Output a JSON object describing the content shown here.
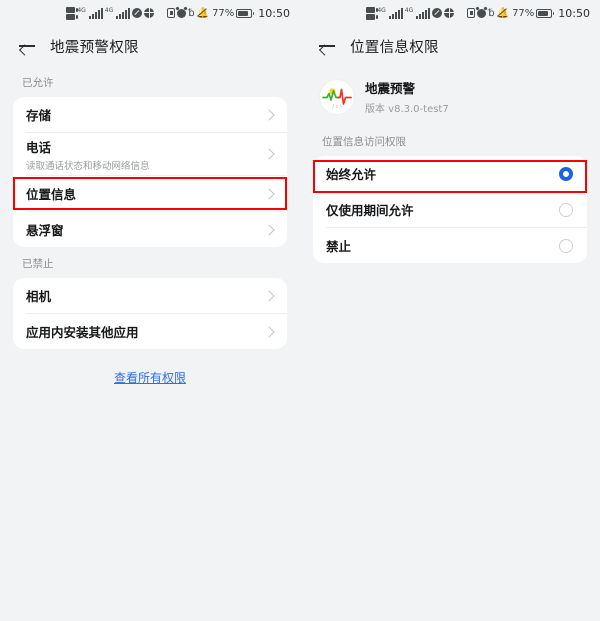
{
  "status_bar": {
    "network_label_1": "4G",
    "network_label_2": "4G",
    "battery_percent": "77%",
    "time": "10:50",
    "icons": [
      "dual-sim-icon",
      "signal-bars-icon",
      "signal-bars-icon",
      "do-not-disturb-icon",
      "globe-icon",
      "vpn-icon",
      "alarm-icon",
      "bluetooth-icon",
      "bell-muted-icon",
      "battery-icon"
    ]
  },
  "left_panel": {
    "title": "地震预警权限",
    "back_icon": "back-arrow-icon",
    "sections": [
      {
        "label": "已允许",
        "items": [
          {
            "title": "存储",
            "subtitle": "",
            "highlighted": false
          },
          {
            "title": "电话",
            "subtitle": "读取通话状态和移动网络信息",
            "highlighted": false
          },
          {
            "title": "位置信息",
            "subtitle": "",
            "highlighted": true
          },
          {
            "title": "悬浮窗",
            "subtitle": "",
            "highlighted": false
          }
        ]
      },
      {
        "label": "已禁止",
        "items": [
          {
            "title": "相机",
            "subtitle": "",
            "highlighted": false
          },
          {
            "title": "应用内安装其他应用",
            "subtitle": "",
            "highlighted": false
          }
        ]
      }
    ],
    "all_permissions_link": "查看所有权限"
  },
  "right_panel": {
    "title": "位置信息权限",
    "back_icon": "back-arrow-icon",
    "app": {
      "name": "地震预警",
      "version": "版本 v8.3.0-test7",
      "icon": "earthquake-warning-app-icon"
    },
    "section_label": "位置信息访问权限",
    "options": [
      {
        "label": "始终允许",
        "selected": true,
        "highlighted": true
      },
      {
        "label": "仅使用期间允许",
        "selected": false,
        "highlighted": false
      },
      {
        "label": "禁止",
        "selected": false,
        "highlighted": false
      }
    ]
  },
  "colors": {
    "background": "#f1f3f4",
    "card": "#ffffff",
    "accent_blue": "#1a63e8",
    "link_blue": "#2f6fe0",
    "highlight_red": "#fb0000",
    "text_primary": "#17181a",
    "text_secondary": "#9a9c9f"
  }
}
